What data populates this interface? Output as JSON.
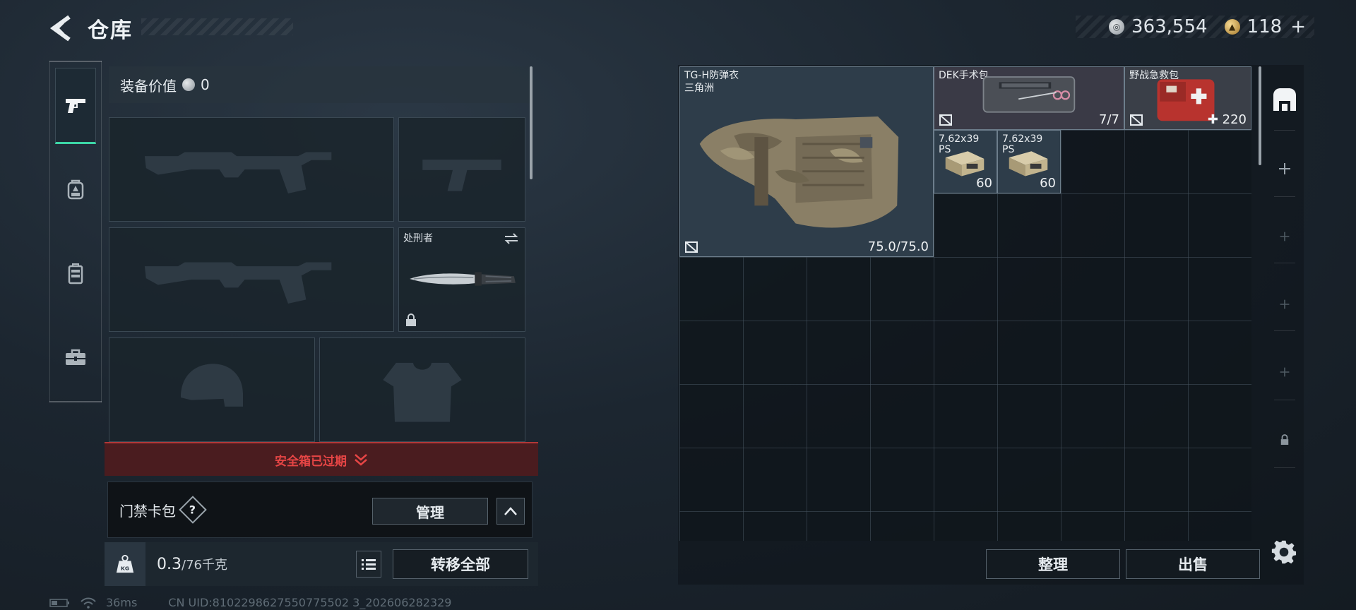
{
  "header": {
    "title": "仓库",
    "currency_silver": "363,554",
    "currency_gold": "118",
    "currency_gold_plus": "+"
  },
  "left_tabs": [
    {
      "name": "weapons",
      "icon": "pistol-icon",
      "active": true
    },
    {
      "name": "backpack",
      "icon": "backpack-icon",
      "active": false
    },
    {
      "name": "rig",
      "icon": "chest-rig-icon",
      "active": false
    },
    {
      "name": "toolbox",
      "icon": "toolbox-icon",
      "active": false
    }
  ],
  "loadout": {
    "value_label": "装备价值",
    "value": "0",
    "melee_label": "处刑者",
    "safe_box_expired": "安全箱已过期",
    "card_pack_label": "门禁卡包",
    "help_label": "?",
    "manage_label": "管理",
    "weight_value": "0.3",
    "weight_max": "/76千克",
    "kg_label": "KG",
    "transfer_all_label": "转移全部"
  },
  "status": {
    "ping": "36ms",
    "uid": "CN UID:8102298627550775502 3_202606282329"
  },
  "stash": {
    "items": [
      {
        "name": "TG-H防弹衣",
        "sub": "三角洲",
        "qty": "75.0/75.0"
      },
      {
        "name": "DEK手术包",
        "qty": "7/7"
      },
      {
        "name": "野战急救包",
        "qty": "220"
      },
      {
        "name": "7.62x39",
        "sub": "PS",
        "qty": "60"
      },
      {
        "name": "7.62x39",
        "sub": "PS",
        "qty": "60"
      }
    ],
    "sort_label": "整理",
    "sell_label": "出售"
  },
  "colors": {
    "accent_green": "#3cd6a6",
    "expired_red": "#e64545",
    "selected_item_bg": "#2e3d4a",
    "medkit_bg": "#3a3f48"
  }
}
